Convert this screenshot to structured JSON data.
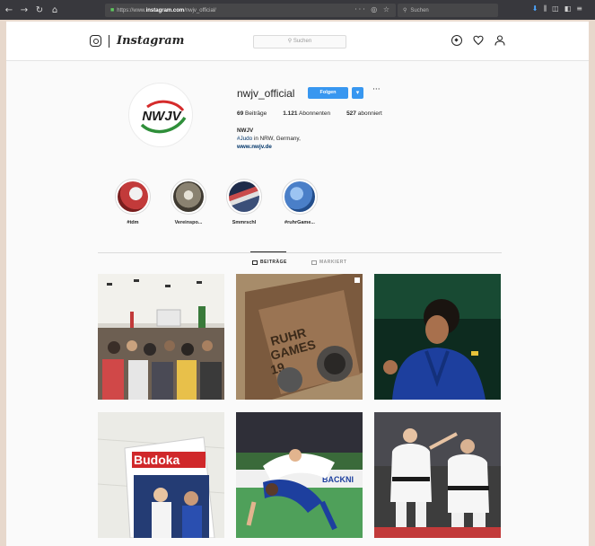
{
  "browser": {
    "url_prefix": "https://www.",
    "url_domain": "instagram.com",
    "url_path": "/nwjv_official/",
    "url_actions": "··· ◎ ☆",
    "search_placeholder": "Suchen",
    "nav_buttons": [
      "←",
      "→",
      "↻",
      "⌂"
    ],
    "tool_icons": [
      "download-icon",
      "library-icon",
      "sidebar-icon",
      "extension-icon",
      "menu-icon"
    ]
  },
  "header": {
    "wordmark": "Instagram",
    "search_placeholder": "Suchen",
    "icons": [
      "compass-icon",
      "heart-icon",
      "user-icon"
    ]
  },
  "profile": {
    "username": "nwjv_official",
    "follow_label": "Folgen",
    "dropdown_glyph": "▾",
    "more_glyph": "···",
    "avatar_text": "NWJV",
    "stats": [
      {
        "count": "69",
        "label": "Beiträge"
      },
      {
        "count": "1.121",
        "label": "Abonnenten"
      },
      {
        "count": "527",
        "label": "abonniert"
      }
    ],
    "name": "NWJV",
    "bio_hashtag": "#Judo",
    "bio_text": " in NRW, Germany,",
    "website": "www.nwjv.de"
  },
  "highlights": [
    {
      "label": "#tdm",
      "color": "#c23a3a"
    },
    {
      "label": "Vereinspo...",
      "color": "#6b6355"
    },
    {
      "label": "Smmrschl",
      "color": "#3b4f78"
    },
    {
      "label": "#ruhrGame...",
      "color": "#4a7fc8"
    }
  ],
  "tabs": [
    {
      "label": "BEITRÄGE",
      "active": true
    },
    {
      "label": "MARKIERT",
      "active": false
    }
  ],
  "colors": {
    "accent": "#3897f0",
    "link": "#003569",
    "text": "#262626",
    "outer_background": "#e7d8cc"
  }
}
